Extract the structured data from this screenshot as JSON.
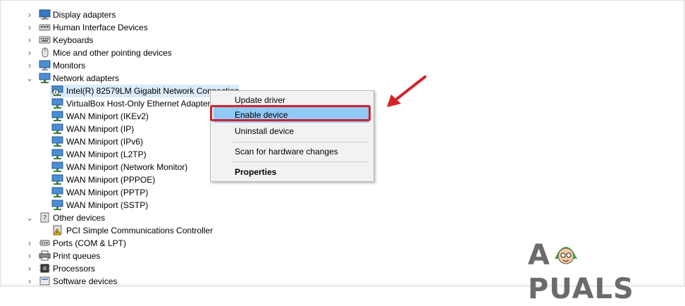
{
  "tree": {
    "categories": [
      {
        "label": "Display adapters",
        "icon": "display-adapter-icon"
      },
      {
        "label": "Human Interface Devices",
        "icon": "hid-icon"
      },
      {
        "label": "Keyboards",
        "icon": "keyboard-icon"
      },
      {
        "label": "Mice and other pointing devices",
        "icon": "mouse-icon"
      },
      {
        "label": "Monitors",
        "icon": "monitor-icon"
      },
      {
        "label": "Network adapters",
        "icon": "network-adapter-icon"
      }
    ],
    "network_adapters": [
      "Intel(R) 82579LM Gigabit Network Connection",
      "VirtualBox Host-Only Ethernet Adapter",
      "WAN Miniport (IKEv2)",
      "WAN Miniport (IP)",
      "WAN Miniport (IPv6)",
      "WAN Miniport (L2TP)",
      "WAN Miniport (Network Monitor)",
      "WAN Miniport (PPPOE)",
      "WAN Miniport (PPTP)",
      "WAN Miniport (SSTP)"
    ],
    "other_devices": {
      "label": "Other devices",
      "children": [
        "PCI Simple Communications Controller"
      ]
    },
    "bottom": [
      "Ports (COM & LPT)",
      "Print queues",
      "Processors",
      "Software devices"
    ]
  },
  "context_menu": {
    "items": [
      {
        "label": "Update driver"
      },
      {
        "label": "Enable device",
        "highlighted": true
      },
      {
        "label": "Uninstall device"
      },
      {
        "label": "Scan for hardware changes"
      },
      {
        "label": "Properties",
        "bold": true
      }
    ]
  },
  "watermark": {
    "text": "APPUALS"
  },
  "colors": {
    "highlight": "#91c9f7",
    "selection": "#dbeaf9",
    "annotation_red": "#d2232a"
  }
}
